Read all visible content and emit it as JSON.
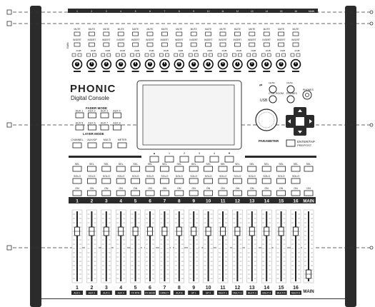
{
  "brand": {
    "logo": "PHONIC",
    "subtitle": "Digital Console"
  },
  "top_strip": {
    "channel_numbers": [
      "1",
      "2",
      "3",
      "4",
      "5",
      "6",
      "7",
      "8",
      "9",
      "10",
      "11",
      "12",
      "13",
      "14",
      "15",
      "16",
      "MAIN"
    ]
  },
  "channel_strip_text": {
    "mute": "MUTE",
    "insert": "INSERT",
    "pad_label": "20dB",
    "left_gain": "GAIN"
  },
  "fader_mode": {
    "title": "FADER MODE",
    "buttons": [
      "AUX 1",
      "AUX 2",
      "AUX 3",
      "AUX 4",
      "AUX 5",
      "AUX 6",
      "AUX 7",
      "AUX 8"
    ]
  },
  "layer_mode": {
    "title": "LAYER MODE",
    "buttons": [
      "CHANNEL",
      "AUX/GP",
      "MULTI",
      "METER"
    ]
  },
  "screen_nav": {
    "labels": [
      "▲",
      "1",
      "2",
      "3",
      "4",
      "▼"
    ]
  },
  "right_panel": {
    "parameter_label": "PARAMETER",
    "enter_label": "ENTER/TAP",
    "enter_sub": "PRE/POST",
    "phones_label": "PHONES",
    "ctrl_room_label": "CTRL ROOM",
    "usb_label": "USB"
  },
  "strip_buttons": {
    "sel": "SEL",
    "solo": "SOLO",
    "on": "ON",
    "main_on": "ON"
  },
  "channels": [
    "1",
    "2",
    "3",
    "4",
    "5",
    "6",
    "7",
    "8",
    "9",
    "10",
    "11",
    "12",
    "13",
    "14",
    "15",
    "16"
  ],
  "main_label": "MAIN",
  "fader_labels": [
    "1",
    "2",
    "3",
    "4",
    "5",
    "6",
    "7",
    "8",
    "9",
    "10",
    "11",
    "12",
    "13",
    "14",
    "15",
    "16"
  ],
  "scribble_labels": [
    "AUX 1",
    "AUX 2",
    "AUX 3",
    "AUX 4",
    "FX RTN",
    "FX SEND",
    "DIRECT",
    "AUX 8",
    "GP 1",
    "GP 2",
    "MULTI 1",
    "MULTI 2",
    "MULTI 3",
    "MULTI 4",
    "MULTI 5",
    "MULTI 6"
  ],
  "fader_main_label": "MAIN",
  "colors": {
    "body": "#ffffff",
    "rail": "#2b2b2b",
    "line": "#333333",
    "screen": "#f4f4f4"
  }
}
